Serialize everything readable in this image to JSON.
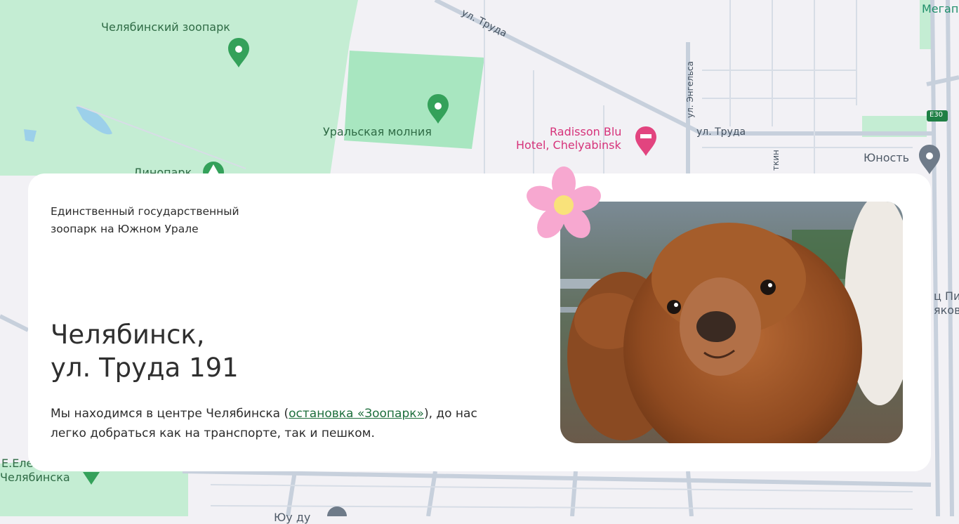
{
  "map": {
    "labels": {
      "zoo": "Челябинский зоопарк",
      "ural_lightning": "Уральская молния",
      "dinopark": "Динопарк",
      "trud_top": "ул. Труда",
      "engels": "ул. Энгельса",
      "trud_right": "ул. Труда",
      "radisson_line1": "Radisson Blu",
      "radisson_line2": "Hotel, Chelyabinsk",
      "yunost": "Юность",
      "megan": "Мегап",
      "e30": "E30",
      "botkin": "ткин",
      "right_partial_1": "ц Пи",
      "right_partial_2": "яков",
      "bottom_left_1": "Е.Еле",
      "bottom_left_2": "Челябинска",
      "bottom_center": "Юу ду"
    },
    "colors": {
      "park": "#c4edd3",
      "park_dark": "#a8e6c0",
      "road": "#c7d0dc",
      "pin_green": "#34a15a",
      "pin_pink": "#e2447f"
    }
  },
  "card": {
    "tagline": "Единственный государственный зоопарк на Южном Урале",
    "address_line1": "Челябинск,",
    "address_line2": "ул. Труда 191",
    "desc_before": "Мы находимся в центре Челябинска (",
    "desc_link": "остановка «Зоопарк»",
    "desc_after": "), до нас легко добраться как на транспорте, так и пешком.",
    "photo_alt": "alpaca-photo"
  }
}
